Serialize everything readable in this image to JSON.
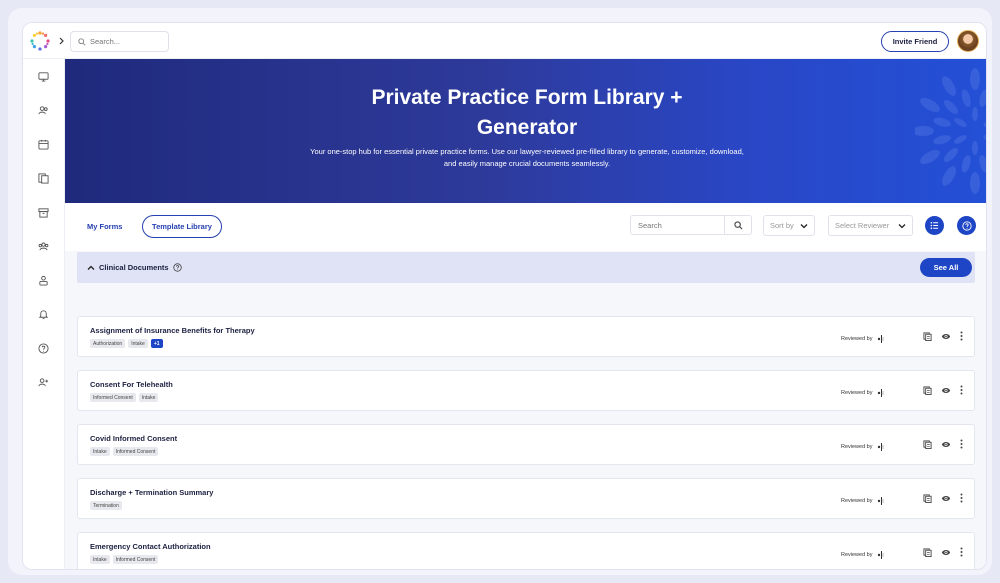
{
  "topbar": {
    "search_placeholder": "Search...",
    "invite_label": "Invite Friend"
  },
  "sidebar": {
    "items": [
      {
        "name": "monitor-icon"
      },
      {
        "name": "users-icon"
      },
      {
        "name": "calendar-icon"
      },
      {
        "name": "documents-icon"
      },
      {
        "name": "archive-icon"
      },
      {
        "name": "group-icon"
      },
      {
        "name": "profile-icon"
      },
      {
        "name": "bell-icon"
      },
      {
        "name": "help-icon"
      },
      {
        "name": "add-user-icon"
      }
    ]
  },
  "hero": {
    "title": "Private Practice Form Library + Generator",
    "subtitle": "Your one-stop hub for essential private practice forms. Use our lawyer-reviewed pre-filled library to generate, customize, download, and easily manage crucial documents seamlessly."
  },
  "controls": {
    "tab_my_forms": "My Forms",
    "tab_template_library": "Template Library",
    "search_placeholder": "Search",
    "sort_placeholder": "Sort by",
    "reviewer_placeholder": "Select Reviewer"
  },
  "section": {
    "title": "Clinical Documents",
    "see_all_label": "See All"
  },
  "forms": [
    {
      "title": "Assignment of Insurance Benefits for Therapy",
      "tags": [
        "Authorization",
        "Intake"
      ],
      "more": "+1",
      "reviewed_label": "Reviewed by"
    },
    {
      "title": "Consent For Telehealth",
      "tags": [
        "Informed Consent",
        "Intake"
      ],
      "more": "",
      "reviewed_label": "Reviewed by"
    },
    {
      "title": "Covid Informed Consent",
      "tags": [
        "Intake",
        "Informed Consent"
      ],
      "more": "",
      "reviewed_label": "Reviewed by"
    },
    {
      "title": "Discharge + Termination Summary",
      "tags": [
        "Termination"
      ],
      "more": "",
      "reviewed_label": "Reviewed by"
    },
    {
      "title": "Emergency Contact Authorization",
      "tags": [
        "Intake",
        "Informed Consent"
      ],
      "more": "",
      "reviewed_label": "Reviewed by"
    }
  ],
  "colors": {
    "accent": "#1e45c5",
    "hero_start": "#1f2a7c",
    "hero_end": "#2350d6"
  }
}
